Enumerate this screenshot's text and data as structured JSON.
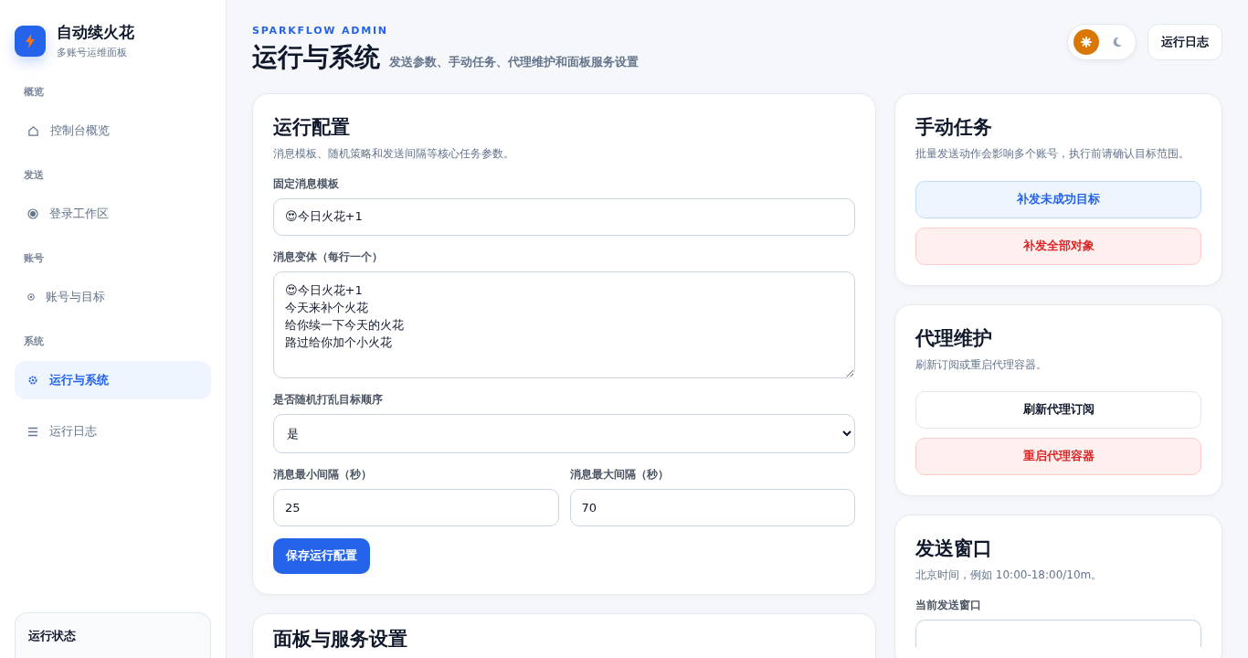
{
  "brand": {
    "title": "自动续火花",
    "subtitle": "多账号运维面板"
  },
  "sidebar": {
    "sections": [
      {
        "heading": "概览",
        "items": [
          {
            "label": "控制台概览",
            "selected": false
          }
        ]
      },
      {
        "heading": "发送",
        "items": [
          {
            "label": "登录工作区",
            "selected": false
          }
        ]
      },
      {
        "heading": "账号",
        "items": [
          {
            "label": "账号与目标",
            "selected": false
          }
        ]
      },
      {
        "heading": "系统",
        "items": [
          {
            "label": "运行与系统",
            "selected": true
          },
          {
            "label": "运行日志",
            "selected": false
          }
        ]
      }
    ],
    "status_card": {
      "title": "运行状态"
    }
  },
  "header": {
    "eyebrow": "SPARKFLOW ADMIN",
    "title": "运行与系统",
    "subtitle": "发送参数、手动任务、代理维护和面板服务设置",
    "theme_toggle": {
      "dark": false
    },
    "log_button": "运行日志"
  },
  "run_config": {
    "title": "运行配置",
    "description": "消息模板、随机策略和发送间隔等核心任务参数。",
    "template": {
      "label": "固定消息模板",
      "value": "😍今日火花+1"
    },
    "variants": {
      "label": "消息变体（每行一个）",
      "lines": [
        "😍今日火花+1",
        "今天来补个火花",
        "给你续一下今天的火花",
        "路过给你加个小火花"
      ]
    },
    "shuffle": {
      "label": "是否随机打乱目标顺序",
      "value": "是"
    },
    "min_interval": {
      "label": "消息最小间隔（秒）",
      "value": "25"
    },
    "max_interval": {
      "label": "消息最大间隔（秒）",
      "value": "70"
    },
    "save_button": "保存运行配置"
  },
  "panel_settings": {
    "title": "面板与服务设置"
  },
  "manual_tasks": {
    "title": "手动任务",
    "description": "批量发送动作会影响多个账号，执行前请确认目标范围。",
    "buttons": [
      {
        "label": "补发未成功目标",
        "kind": "soft"
      },
      {
        "label": "补发全部对象",
        "kind": "danger"
      }
    ]
  },
  "proxy": {
    "title": "代理维护",
    "description": "刷新订阅或重启代理容器。",
    "buttons": [
      {
        "label": "刷新代理订阅",
        "kind": "plain"
      },
      {
        "label": "重启代理容器",
        "kind": "danger"
      }
    ]
  },
  "send_window": {
    "title": "发送窗口",
    "description": "北京时间，例如 10:00-18:00/10m。",
    "field_label": "当前发送窗口"
  }
}
